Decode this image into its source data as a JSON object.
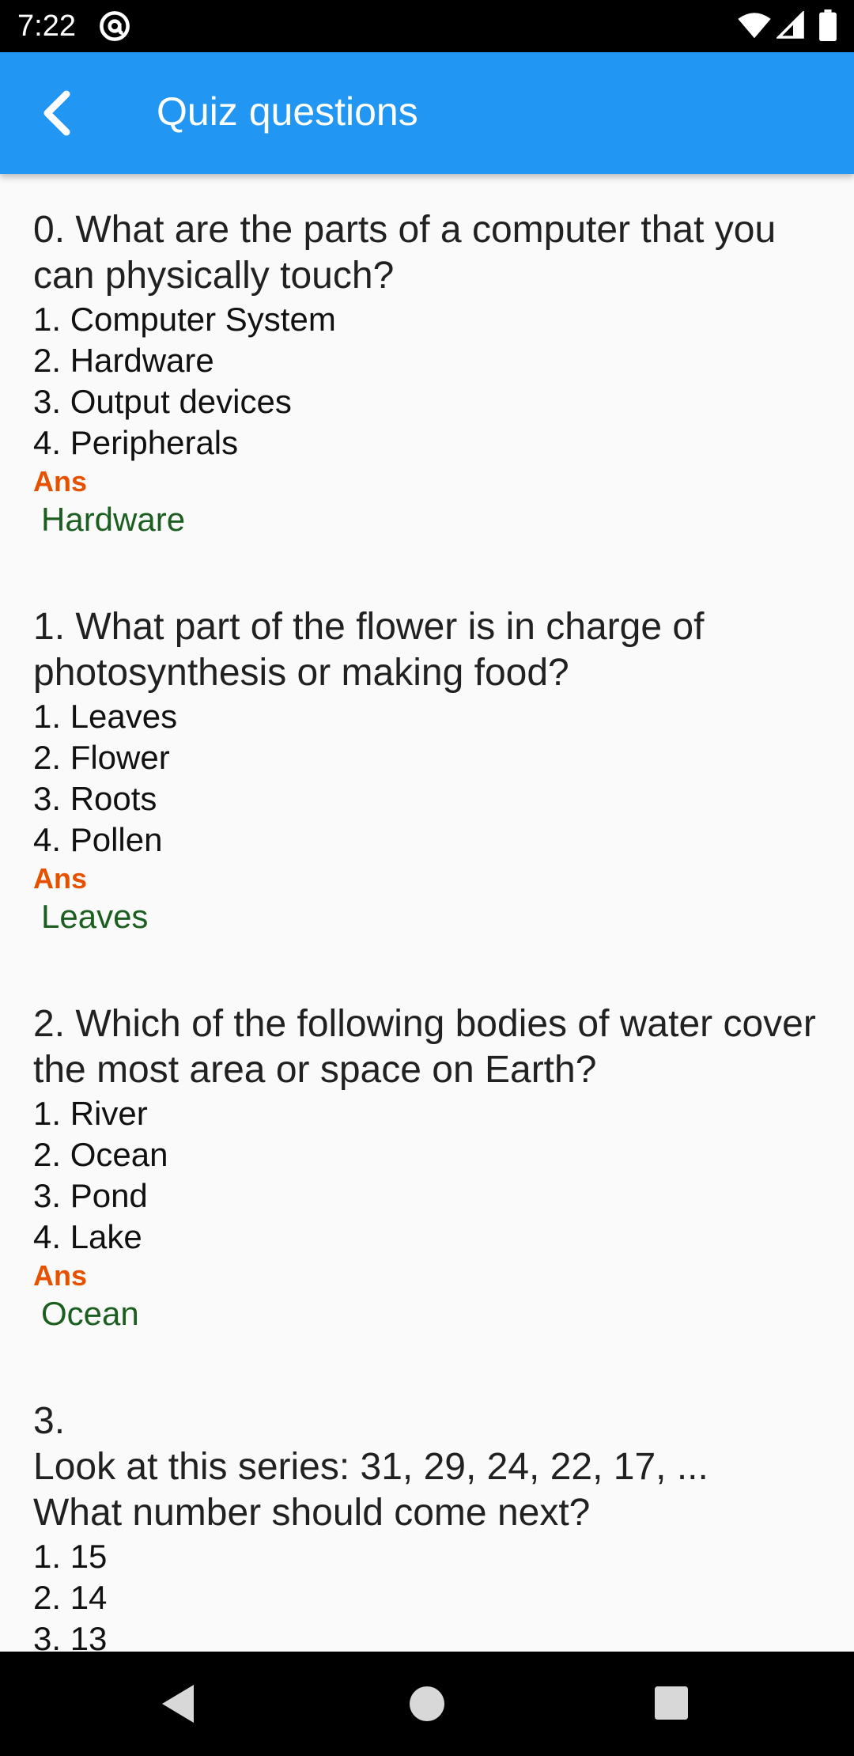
{
  "status_bar": {
    "time": "7:22",
    "icons": [
      "at-sign-icon",
      "wifi-icon",
      "signal-icon",
      "battery-icon"
    ]
  },
  "app_bar": {
    "title": "Quiz questions",
    "back_icon": "chevron-left-icon",
    "color": "#2196f3"
  },
  "colors": {
    "ans_label": "#e65100",
    "ans_value": "#1b5e20"
  },
  "questions": [
    {
      "text": "0. What are the parts of a computer that you can physically touch?",
      "options": [
        "1. Computer System",
        "2. Hardware",
        "3. Output devices",
        "4. Peripherals"
      ],
      "ans_label": "Ans",
      "answer": "Hardware"
    },
    {
      "text": "1. What part of the flower is in charge of photosynthesis or making food?",
      "options": [
        "1. Leaves",
        "2. Flower",
        "3. Roots",
        "4. Pollen"
      ],
      "ans_label": "Ans",
      "answer": "Leaves"
    },
    {
      "text": "2. Which of the following bodies of water cover the most area or space on Earth?",
      "options": [
        "1. River",
        "2. Ocean",
        "3. Pond",
        "4. Lake"
      ],
      "ans_label": "Ans",
      "answer": "Ocean"
    },
    {
      "text": "3.\nLook at this series: 31, 29, 24, 22, 17, ...\nWhat number should come next?",
      "options": [
        "1. 15",
        "2. 14",
        "3. 13"
      ]
    }
  ],
  "nav_bar": {
    "icons": [
      "nav-back-icon",
      "nav-home-icon",
      "nav-recents-icon"
    ]
  }
}
